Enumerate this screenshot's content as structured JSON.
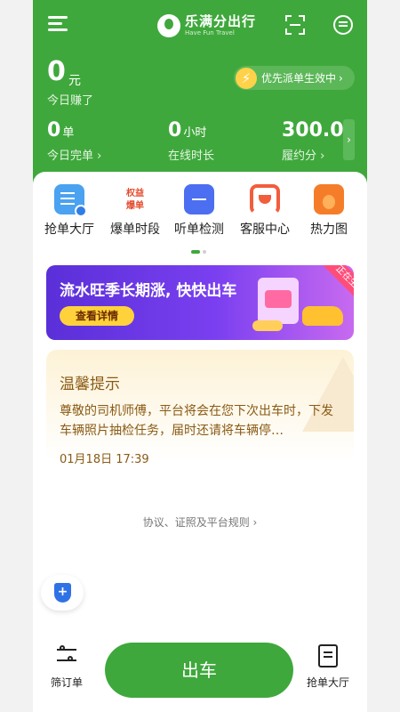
{
  "app": {
    "name_cn": "乐满分出行",
    "name_en": "Have Fun Travel"
  },
  "earnings": {
    "amount": "0",
    "unit": "元",
    "label": "今日赚了"
  },
  "priority": {
    "label": "优先派单生效中",
    "chevron": "›"
  },
  "stats": [
    {
      "value": "0",
      "unit": "单",
      "label": "今日完单 ›"
    },
    {
      "value": "0",
      "unit": "小时",
      "label": "在线时长"
    },
    {
      "value": "300.0",
      "unit": "",
      "label": "履约分 ›"
    }
  ],
  "more_arrow": "›",
  "quick_actions": [
    {
      "label": "抢单大厅",
      "icon": "grab-order-hall-icon"
    },
    {
      "label": "爆单时段",
      "icon": "burst-period-icon",
      "icon_text": "权益\n爆单"
    },
    {
      "label": "听单检测",
      "icon": "listen-check-icon"
    },
    {
      "label": "客服中心",
      "icon": "customer-service-icon"
    },
    {
      "label": "热力图",
      "icon": "heat-map-icon"
    }
  ],
  "banner": {
    "title": "流水旺季长期涨, 快快出车",
    "button": "查看详情",
    "ribbon": "正在生效"
  },
  "notice": {
    "title": "温馨提示",
    "body": "尊敬的司机师傅，平台将会在您下次出车时，下发车辆照片抽检任务，届时还请将车辆停…",
    "date": "01月18日 17:39"
  },
  "rules_link": "协议、证照及平台规则 ›",
  "bottom": {
    "filter_label": "筛订单",
    "go_label": "出车",
    "grab_label": "抢单大厅"
  },
  "colors": {
    "brand_green": "#3fa83c",
    "banner_purple": "#5a2fd8",
    "notice_brown": "#8a5a14"
  }
}
